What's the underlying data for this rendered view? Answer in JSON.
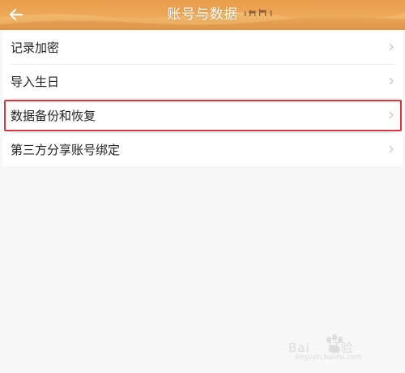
{
  "header": {
    "title": "账号与数据",
    "back_icon": "back-arrow-icon"
  },
  "menu": {
    "items": [
      {
        "label": "记录加密"
      },
      {
        "label": "导入生日"
      },
      {
        "label": "数据备份和恢复",
        "highlighted": true
      },
      {
        "label": "第三方分享账号绑定"
      }
    ],
    "chevron_icon": "chevron-right-icon"
  },
  "watermark": {
    "brand": "Bai",
    "brand_tail": "经验",
    "url": "jingyan.baidu.com"
  },
  "colors": {
    "header_sand": "#efb05f",
    "highlight_border": "#d9363e",
    "page_background": "#f7f7f7"
  }
}
